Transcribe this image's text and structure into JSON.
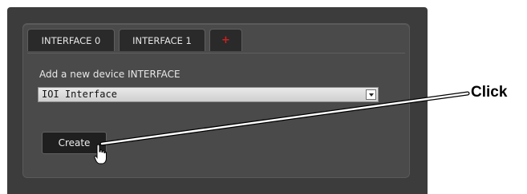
{
  "tabs": [
    {
      "label": "INTERFACE 0"
    },
    {
      "label": "INTERFACE 1"
    },
    {
      "label": "+",
      "icon": "plus-icon",
      "color": "#d02020"
    }
  ],
  "form": {
    "label": "Add a new device INTERFACE",
    "select_value": "IOI Interface",
    "create_label": "Create"
  },
  "annotation": {
    "callout": "Click",
    "cursor_icon": "hand-pointer-icon"
  }
}
